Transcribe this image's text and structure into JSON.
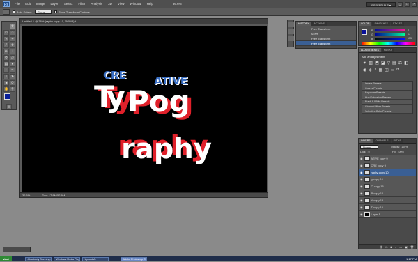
{
  "app": {
    "logo": "Ps"
  },
  "menubar": {
    "items": [
      "File",
      "Edit",
      "Image",
      "Layer",
      "Select",
      "Filter",
      "Analysis",
      "3D",
      "View",
      "Window",
      "Help"
    ],
    "zoom": "36.6%",
    "workspace": "ESSENTIALS ▾",
    "win_buttons": [
      "_",
      "□",
      "×"
    ]
  },
  "optionsbar": {
    "autoselect_label": "Auto-Select:",
    "autoselect_value": "Group",
    "transform_label": "Show Transform Controls"
  },
  "document": {
    "title": "Untitled-1 @ 36% (raphy copy 10, RGB/8) * ",
    "zoom": "36.6%",
    "doc_info": "Doc: 17.8M/52.9M"
  },
  "artwork": {
    "cre": "CRE",
    "ative": "ATIVE",
    "ty": "Ty",
    "pog": "Pog",
    "raphy": "raphy",
    "colors": {
      "white": "#ffffff",
      "red": "#e0202a",
      "blue": "#3a6fc4"
    }
  },
  "history_panel": {
    "tabs": [
      "HISTORY",
      "ACTIONS"
    ],
    "rows": [
      "Free Transform",
      "Move",
      "Free Transform",
      "Free Transform"
    ],
    "active_index": 3
  },
  "color_panel": {
    "tabs": [
      "COLOR",
      "SWATCHES",
      "STYLES"
    ],
    "channels": [
      {
        "label": "R",
        "value": "0"
      },
      {
        "label": "G",
        "value": "17"
      },
      {
        "label": "B",
        "value": "153"
      }
    ]
  },
  "adjustments_panel": {
    "tabs": [
      "ADJUSTMENTS",
      "MASKS"
    ],
    "title": "Add an adjustment",
    "presets": [
      "Levels Presets",
      "Curves Presets",
      "Exposure Presets",
      "Hue/Saturation Presets",
      "Black & White Presets",
      "Channel Mixer Presets",
      "Selective Color Presets"
    ]
  },
  "layers_panel": {
    "tabs": [
      "LAYERS",
      "CHANNELS",
      "PATHS"
    ],
    "blend_mode": "Normal",
    "opacity_label": "Opacity:",
    "opacity_value": "100%",
    "lock_label": "Lock:",
    "fill_label": "Fill:",
    "fill_value": "100%",
    "layers": [
      "ATIVE copy 9",
      "CRE copy 9",
      "raphy copy 10",
      "g copy 16",
      "O copy 16",
      "P copy 16",
      "Y copy 15",
      "T copy 10",
      "Layer 1"
    ],
    "active_index": 2
  },
  "taskbar": {
    "start": "start",
    "tasks": [
      "Absolutely Stunning G...",
      "Windows Media Player",
      "UploadMe",
      "Adobe Photoshop CS4..."
    ],
    "active_index": 3,
    "clock": "1:17 PM"
  }
}
